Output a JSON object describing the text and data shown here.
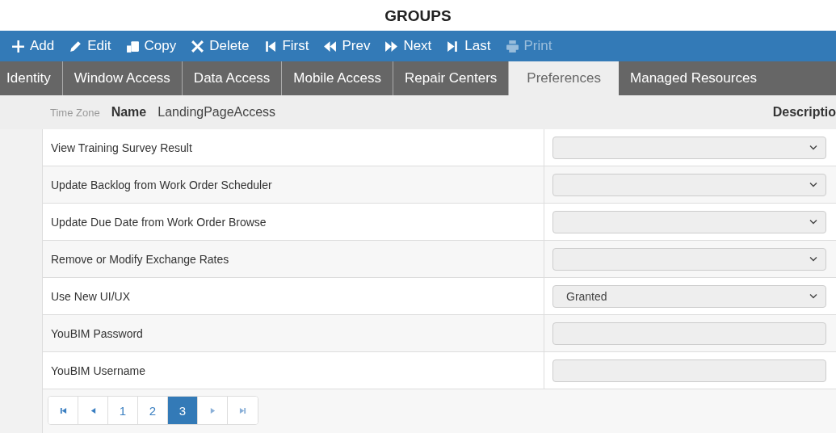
{
  "title": "GROUPS",
  "toolbar": [
    {
      "label": "Add",
      "kind": "plus",
      "disabled": false
    },
    {
      "label": "Edit",
      "kind": "pencil",
      "disabled": false
    },
    {
      "label": "Copy",
      "kind": "copy",
      "disabled": false
    },
    {
      "label": "Delete",
      "kind": "times",
      "disabled": false
    },
    {
      "label": "First",
      "kind": "first",
      "disabled": false
    },
    {
      "label": "Prev",
      "kind": "prev",
      "disabled": false
    },
    {
      "label": "Next",
      "kind": "next",
      "disabled": false
    },
    {
      "label": "Last",
      "kind": "last",
      "disabled": false
    },
    {
      "label": "Print",
      "kind": "print",
      "disabled": true
    }
  ],
  "tabs": [
    {
      "label": "Identity",
      "selected": false
    },
    {
      "label": "Window Access",
      "selected": false
    },
    {
      "label": "Data Access",
      "selected": false
    },
    {
      "label": "Mobile Access",
      "selected": false
    },
    {
      "label": "Repair Centers",
      "selected": false
    },
    {
      "label": "Preferences",
      "selected": true
    },
    {
      "label": "Managed Resources",
      "selected": false
    }
  ],
  "header": {
    "faded_label": "Time Zone",
    "name_label": "Name",
    "name_value": "LandingPageAccess",
    "description_label": "Descriptio"
  },
  "rows": [
    {
      "label": "View Training Survey Result",
      "kind": "select",
      "value": ""
    },
    {
      "label": "Update Backlog from Work Order Scheduler",
      "kind": "select",
      "value": ""
    },
    {
      "label": "Update Due Date from Work Order Browse",
      "kind": "select",
      "value": ""
    },
    {
      "label": "Remove or Modify Exchange Rates",
      "kind": "select",
      "value": ""
    },
    {
      "label": "Use New UI/UX",
      "kind": "select",
      "value": "Granted"
    },
    {
      "label": "YouBIM Password",
      "kind": "text",
      "value": ""
    },
    {
      "label": "YouBIM Username",
      "kind": "text",
      "value": ""
    }
  ],
  "pager": [
    {
      "kind": "first",
      "selected": false
    },
    {
      "kind": "prev",
      "selected": false
    },
    {
      "kind": "page",
      "label": "1",
      "selected": false
    },
    {
      "kind": "page",
      "label": "2",
      "selected": false
    },
    {
      "kind": "page",
      "label": "3",
      "selected": true
    },
    {
      "kind": "next",
      "selected": false
    },
    {
      "kind": "last",
      "selected": false
    }
  ]
}
